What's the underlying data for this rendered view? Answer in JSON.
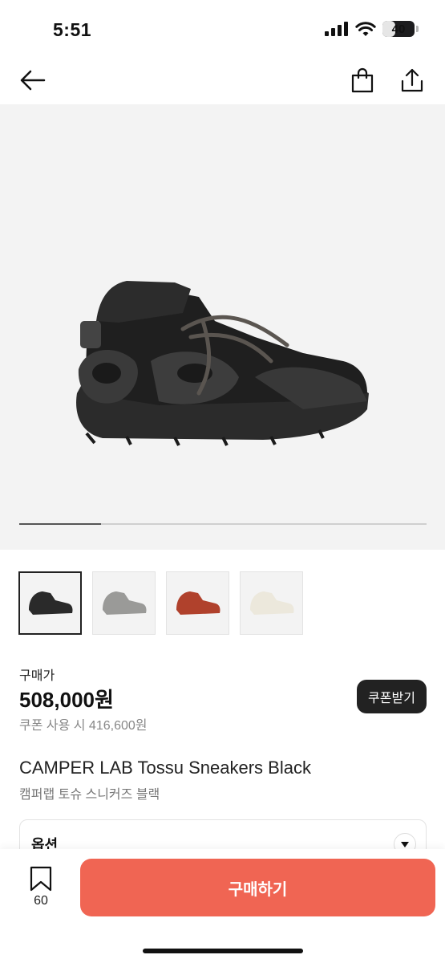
{
  "status_bar": {
    "time": "5:51",
    "battery": "40",
    "battery_level": 0.4
  },
  "nav": {
    "back_icon": "arrow-left-icon",
    "bag_icon": "shopping-bag-icon",
    "share_icon": "share-icon"
  },
  "gallery": {
    "current_index": 1,
    "total": 4,
    "progress": 0.2
  },
  "thumbnails": [
    {
      "color_name": "black",
      "hex": "#2a2a2a",
      "selected": true
    },
    {
      "color_name": "grey",
      "hex": "#9a9a98",
      "selected": false
    },
    {
      "color_name": "red",
      "hex": "#b0412c",
      "selected": false
    },
    {
      "color_name": "white",
      "hex": "#ece8dc",
      "selected": false
    }
  ],
  "price": {
    "label": "구매가",
    "amount": "508,000원",
    "coupon_price": "쿠폰 사용 시 416,600원",
    "coupon_button": "쿠폰받기"
  },
  "product": {
    "name": "CAMPER LAB Tossu Sneakers Black",
    "name_ko": "캠퍼랩 토슈 스니커즈 블랙"
  },
  "options": {
    "label": "옵션"
  },
  "bottom_bar": {
    "bookmark_count": "60",
    "buy_label": "구매하기"
  },
  "colors": {
    "accent": "#f06553",
    "dark": "#222222"
  }
}
